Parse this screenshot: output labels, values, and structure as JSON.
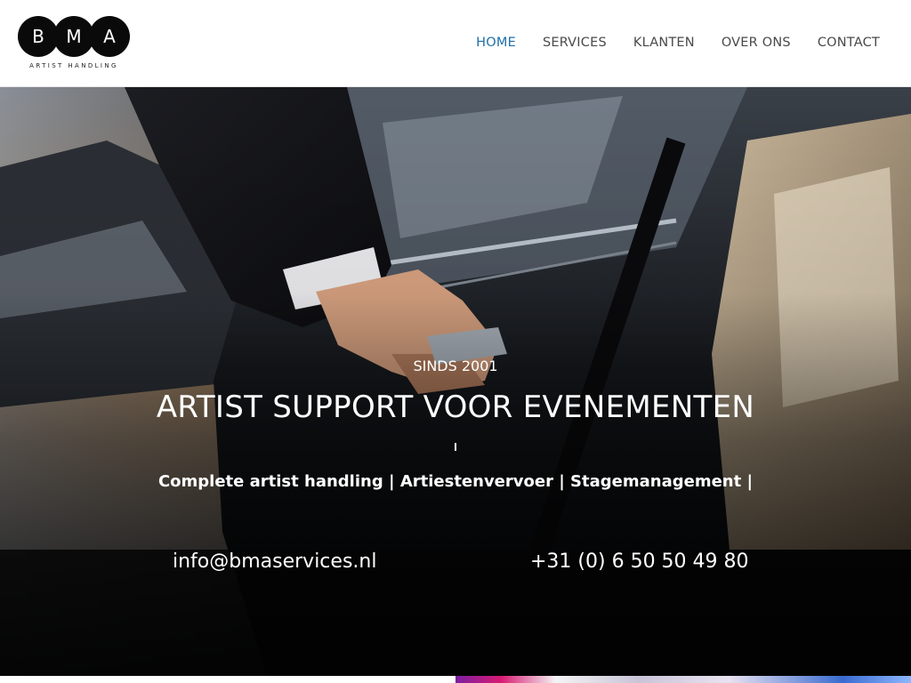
{
  "brand": {
    "letters": [
      "B",
      "M",
      "A"
    ],
    "tagline": "ARTIST HANDLING"
  },
  "nav": {
    "items": [
      {
        "label": "HOME",
        "active": true
      },
      {
        "label": "SERVICES",
        "active": false
      },
      {
        "label": "KLANTEN",
        "active": false
      },
      {
        "label": "OVER ONS",
        "active": false
      },
      {
        "label": "CONTACT",
        "active": false
      }
    ]
  },
  "hero": {
    "since": "SINDS 2001",
    "headline": "ARTIST SUPPORT VOOR EVENEMENTEN",
    "services": "Complete artist handling | Artiestenvervoer | Stagemanagement |",
    "email": "info@bmaservices.nl",
    "phone": "+31 (0) 6 50 50 49 80"
  },
  "colors": {
    "nav_active": "#1e6fa8",
    "nav_default": "#4a4a4a",
    "hero_text": "#ffffff",
    "logo_circle": "#0a0a0a"
  }
}
